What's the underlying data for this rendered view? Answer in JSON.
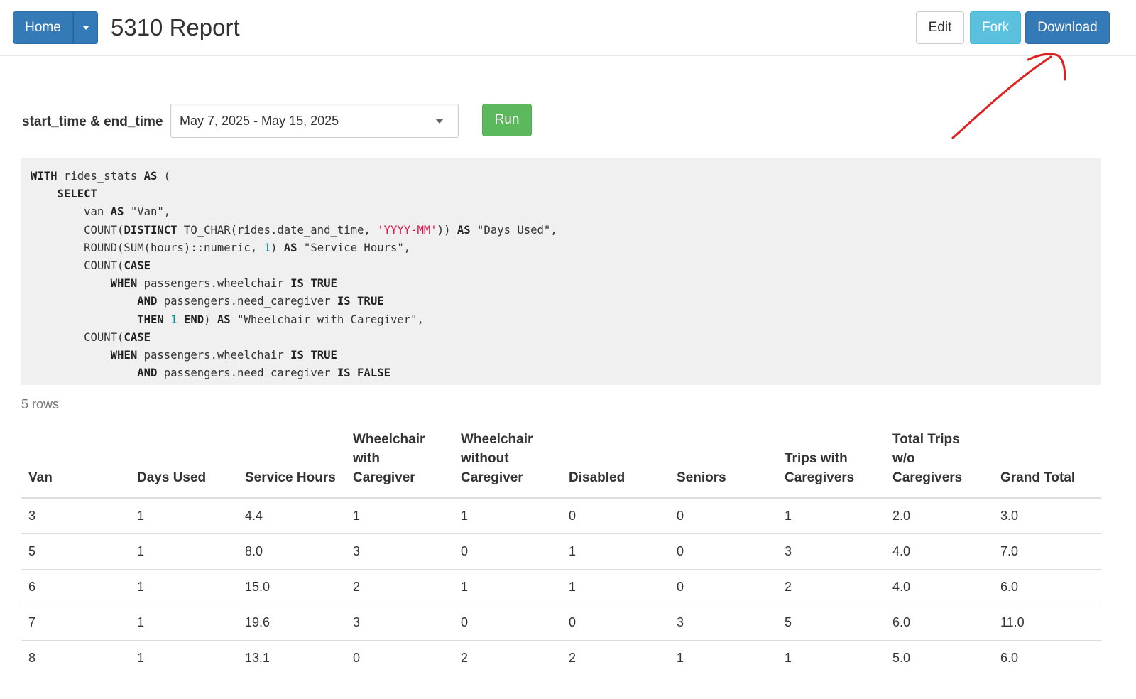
{
  "header": {
    "home_label": "Home",
    "title": "5310 Report",
    "edit_label": "Edit",
    "fork_label": "Fork",
    "download_label": "Download"
  },
  "params": {
    "label": "start_time & end_time",
    "date_range_value": "May 7, 2025 - May 15, 2025",
    "run_label": "Run"
  },
  "code": {
    "language": "sql",
    "lines": [
      "WITH rides_stats AS (",
      "    SELECT",
      "        van AS \"Van\",",
      "        COUNT(DISTINCT TO_CHAR(rides.date_and_time, 'YYYY-MM')) AS \"Days Used\",",
      "        ROUND(SUM(hours)::numeric, 1) AS \"Service Hours\",",
      "        COUNT(CASE",
      "            WHEN passengers.wheelchair IS TRUE",
      "                AND passengers.need_caregiver IS TRUE",
      "                THEN 1 END) AS \"Wheelchair with Caregiver\",",
      "        COUNT(CASE",
      "            WHEN passengers.wheelchair IS TRUE",
      "                AND passengers.need_caregiver IS FALSE"
    ]
  },
  "results": {
    "row_count_label": "5 rows",
    "columns": [
      [
        "Van"
      ],
      [
        "Days Used"
      ],
      [
        "Service Hours"
      ],
      [
        "Wheelchair",
        "with",
        "Caregiver"
      ],
      [
        "Wheelchair",
        "without",
        "Caregiver"
      ],
      [
        "Disabled"
      ],
      [
        "Seniors"
      ],
      [
        "Trips with",
        "Caregivers"
      ],
      [
        "Total Trips",
        "w/o",
        "Caregivers"
      ],
      [
        "Grand Total"
      ]
    ],
    "rows": [
      [
        "3",
        "1",
        "4.4",
        "1",
        "1",
        "0",
        "0",
        "1",
        "2.0",
        "3.0"
      ],
      [
        "5",
        "1",
        "8.0",
        "3",
        "0",
        "1",
        "0",
        "3",
        "4.0",
        "7.0"
      ],
      [
        "6",
        "1",
        "15.0",
        "2",
        "1",
        "1",
        "0",
        "2",
        "4.0",
        "6.0"
      ],
      [
        "7",
        "1",
        "19.6",
        "3",
        "0",
        "0",
        "3",
        "5",
        "6.0",
        "11.0"
      ],
      [
        "8",
        "1",
        "13.1",
        "0",
        "2",
        "2",
        "1",
        "1",
        "5.0",
        "6.0"
      ]
    ]
  },
  "colors": {
    "primary": "#337ab7",
    "info": "#5bc0de",
    "success": "#5cb85c",
    "annotation": "#e02020",
    "code_bg": "#f0f0f0"
  }
}
